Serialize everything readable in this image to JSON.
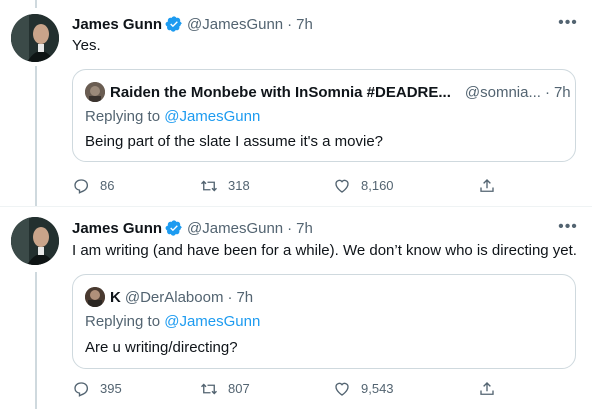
{
  "colors": {
    "accent": "#1d9bf0",
    "secondary_text": "#536471",
    "border": "#cfd9de"
  },
  "tweets": [
    {
      "author_name": "James Gunn",
      "handle": "@JamesGunn",
      "separator": "·",
      "time": "7h",
      "text": "Yes.",
      "quote": {
        "author_name": "Raiden the Monbebe with InSomnia #DEADRE...",
        "handle": "@somnia...",
        "separator": "·",
        "time": "7h",
        "replying_prefix": "Replying to ",
        "replying_to": "@JamesGunn",
        "text": "Being part of the slate I assume it's a movie?"
      },
      "replies": "86",
      "retweets": "318",
      "likes": "8,160"
    },
    {
      "author_name": "James Gunn",
      "handle": "@JamesGunn",
      "separator": "·",
      "time": "7h",
      "text": "I am writing (and have been for a while). We don’t know who is directing yet.",
      "quote": {
        "author_name": "K",
        "handle": "@DerAlaboom",
        "separator": "·",
        "time": "7h",
        "replying_prefix": "Replying to ",
        "replying_to": "@JamesGunn",
        "text": "Are u writing/directing?"
      },
      "replies": "395",
      "retweets": "807",
      "likes": "9,543"
    }
  ],
  "icons": {
    "verified": "verified-badge-icon",
    "more": "more-options-icon",
    "reply": "reply-icon",
    "retweet": "retweet-icon",
    "like": "heart-icon",
    "share": "share-icon"
  }
}
